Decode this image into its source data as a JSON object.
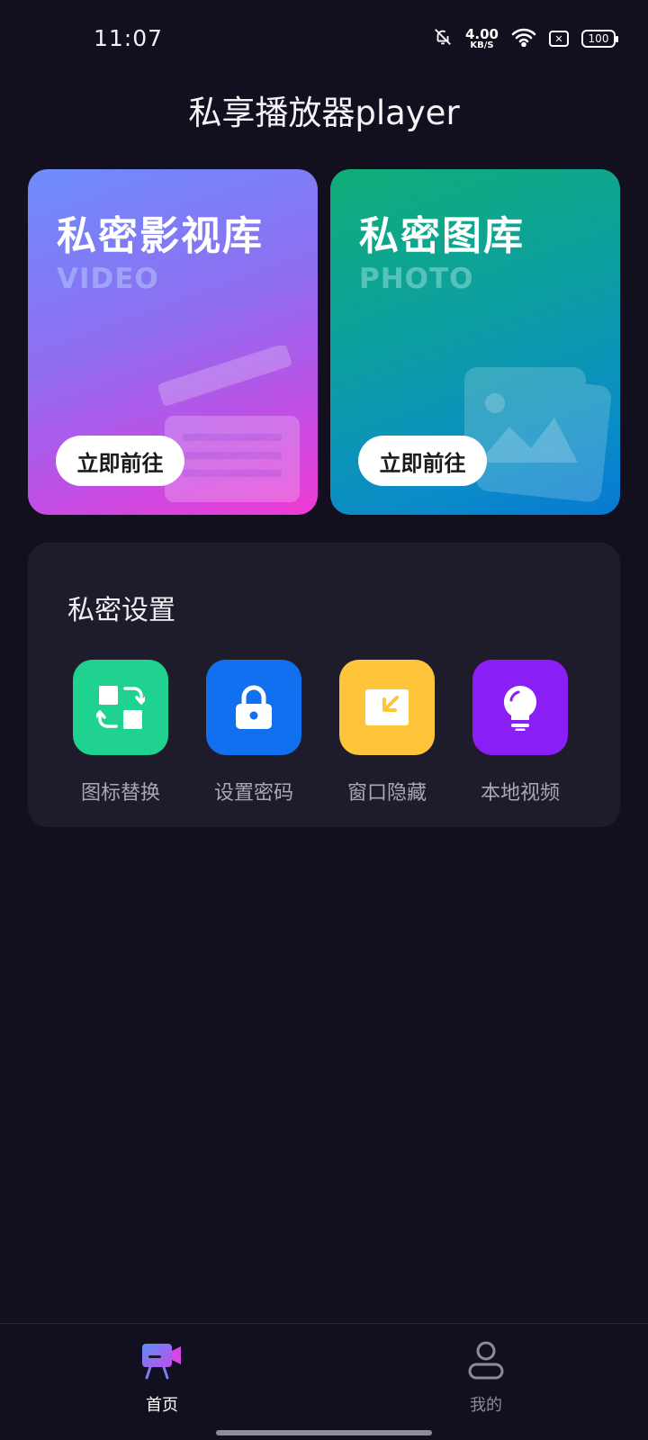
{
  "status_bar": {
    "time": "11:07",
    "net_speed_value": "4.00",
    "net_speed_unit": "KB/S",
    "battery": "100",
    "icons": [
      "bell-off-icon",
      "wifi-icon",
      "sim-off-icon",
      "battery-icon"
    ]
  },
  "header": {
    "title": "私享播放器player"
  },
  "cards": [
    {
      "title": "私密影视库",
      "subtitle": "VIDEO",
      "button": "立即前往",
      "icon": "clapperboard-icon"
    },
    {
      "title": "私密图库",
      "subtitle": "PHOTO",
      "button": "立即前往",
      "icon": "gallery-icon"
    }
  ],
  "settings": {
    "title": "私密设置",
    "items": [
      {
        "label": "图标替换",
        "icon": "swap-icon",
        "color": "#1fd28f"
      },
      {
        "label": "设置密码",
        "icon": "lock-icon",
        "color": "#1170ef"
      },
      {
        "label": "窗口隐藏",
        "icon": "minimize-window-icon",
        "color": "#ffc53a"
      },
      {
        "label": "本地视频",
        "icon": "bulb-icon",
        "color": "#8a1ff5"
      }
    ]
  },
  "bottom_nav": [
    {
      "label": "首页",
      "icon": "video-camera-icon",
      "active": true
    },
    {
      "label": "我的",
      "icon": "user-icon",
      "active": false
    }
  ],
  "colors": {
    "background": "#120f1f",
    "panel": "#1e1b2b",
    "video_gradient": [
      "#6d8dfb",
      "#f03ad3"
    ],
    "photo_gradient": [
      "#0fae77",
      "#0779d4"
    ]
  }
}
